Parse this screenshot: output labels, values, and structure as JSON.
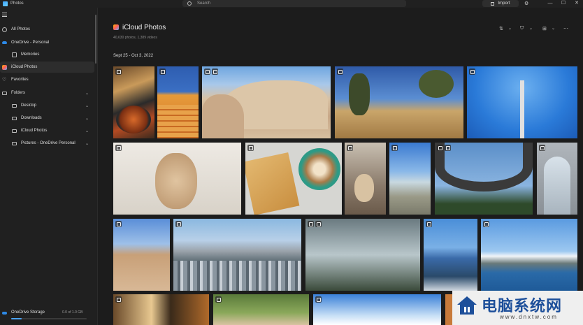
{
  "window": {
    "app_title": "Photos",
    "search_placeholder": "Search",
    "import_label": "Import",
    "minimize": "—",
    "maximize": "☐",
    "close": "✕"
  },
  "sidebar": {
    "items": [
      {
        "label": "All Photos",
        "icon": "photos-icon"
      },
      {
        "label": "OneDrive - Personal",
        "icon": "cloud-icon"
      },
      {
        "label": "Memories",
        "icon": "memories-icon"
      },
      {
        "label": "iCloud Photos",
        "icon": "icloud-icon",
        "selected": true
      },
      {
        "label": "Favorites",
        "icon": "star-icon"
      },
      {
        "label": "Folders",
        "icon": "folder-icon"
      },
      {
        "label": "Desktop",
        "icon": "folder-icon"
      },
      {
        "label": "Downloads",
        "icon": "folder-icon"
      },
      {
        "label": "iCloud Photos",
        "icon": "folder-icon"
      },
      {
        "label": "Pictures - OneDrive Personal",
        "icon": "folder-icon"
      }
    ],
    "storage": {
      "label": "OneDrive Storage",
      "amount": "0.0 of 1.0 GB",
      "used_fraction": 0.14
    }
  },
  "main": {
    "title": "iCloud Photos",
    "subtitle": "40,630 photos, 1,389 videos",
    "date_range": "Sept 25 - Oct 3, 2022",
    "toolbar": {
      "sort": "⇅",
      "filter": "⛉",
      "view": "⊞",
      "more": "⋯",
      "chevron": "⌄"
    }
  },
  "watermark": {
    "title": "电脑系统网",
    "url": "www.dnxtw.com"
  },
  "colors": {
    "accent": "#4aa3ff",
    "onedrive": "#2d89e6",
    "background": "#1c1c1c",
    "sidebar": "#202020"
  }
}
